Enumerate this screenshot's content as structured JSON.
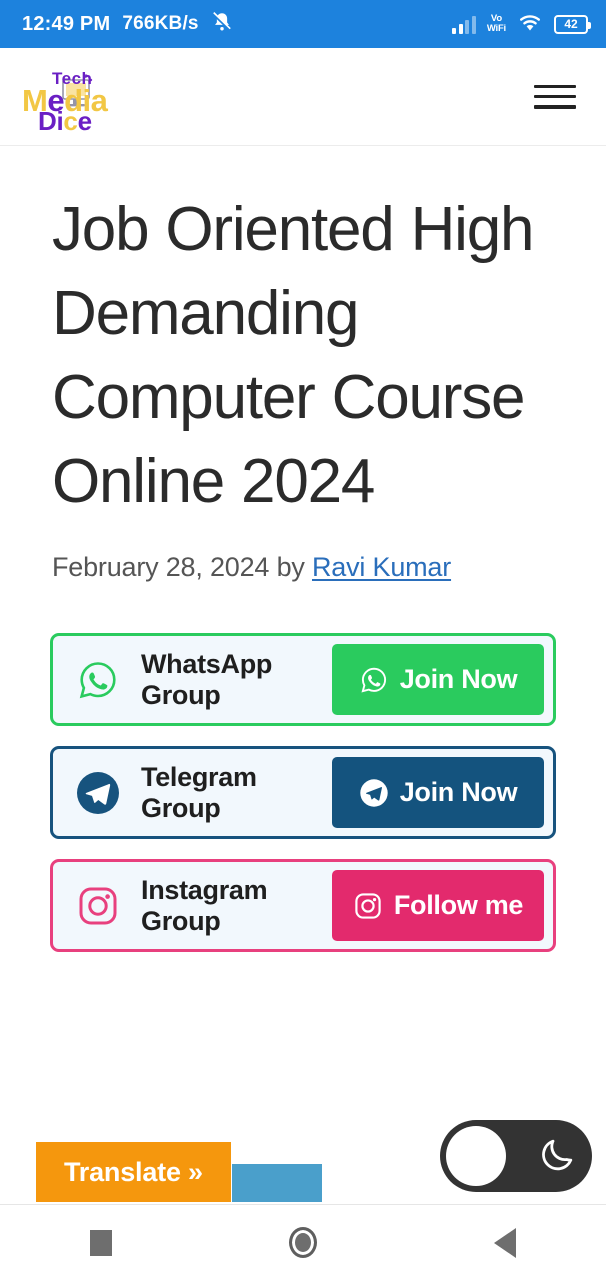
{
  "status_bar": {
    "time": "12:49 PM",
    "network_speed": "766KB/s",
    "mute_icon": "bell-slash-icon",
    "signal_icon": "signal-bars-icon",
    "vowifi_line1": "Vo",
    "vowifi_line2": "WiFi",
    "wifi_icon": "wifi-icon",
    "battery_level": "42",
    "background_color": "#1d82dd"
  },
  "header": {
    "logo": {
      "tech": "Tech",
      "media_m": "M",
      "media_e": "e",
      "media_rest": "dia",
      "dice_d": "D",
      "dice_i": "i",
      "dice_c": "c",
      "dice_e": "e",
      "mark_icon": "computer-monitor-icon",
      "color_yellow": "#f2c744",
      "color_purple": "#6a1fc4"
    },
    "menu_icon": "hamburger-menu-icon"
  },
  "article": {
    "title": "Job Oriented High Demanding Computer Course Online 2024",
    "date": "February 28, 2024",
    "by_word": "by",
    "author": "Ravi Kumar",
    "author_link_color": "#2a6ebb"
  },
  "social": {
    "rows": [
      {
        "name": "whatsapp",
        "icon": "whatsapp-icon",
        "label": "WhatsApp Group",
        "button_label": "Join Now",
        "button_icon": "whatsapp-icon",
        "accent_color": "#2acb5e"
      },
      {
        "name": "telegram",
        "icon": "telegram-icon",
        "label": "Telegram Group",
        "button_label": "Join Now",
        "button_icon": "telegram-icon",
        "accent_color": "#14537e"
      },
      {
        "name": "instagram",
        "icon": "instagram-icon",
        "label": "Instagram Group",
        "button_label": "Follow me",
        "button_icon": "instagram-icon",
        "accent_color": "#e32a6d"
      }
    ]
  },
  "widgets": {
    "translate_label": "Translate »",
    "translate_color": "#f5970d",
    "dark_mode_icon": "crescent-moon-icon",
    "dark_mode_state": "off"
  },
  "nav_bar": {
    "recents_icon": "square-recents-icon",
    "home_icon": "circle-home-icon",
    "back_icon": "triangle-back-icon"
  }
}
